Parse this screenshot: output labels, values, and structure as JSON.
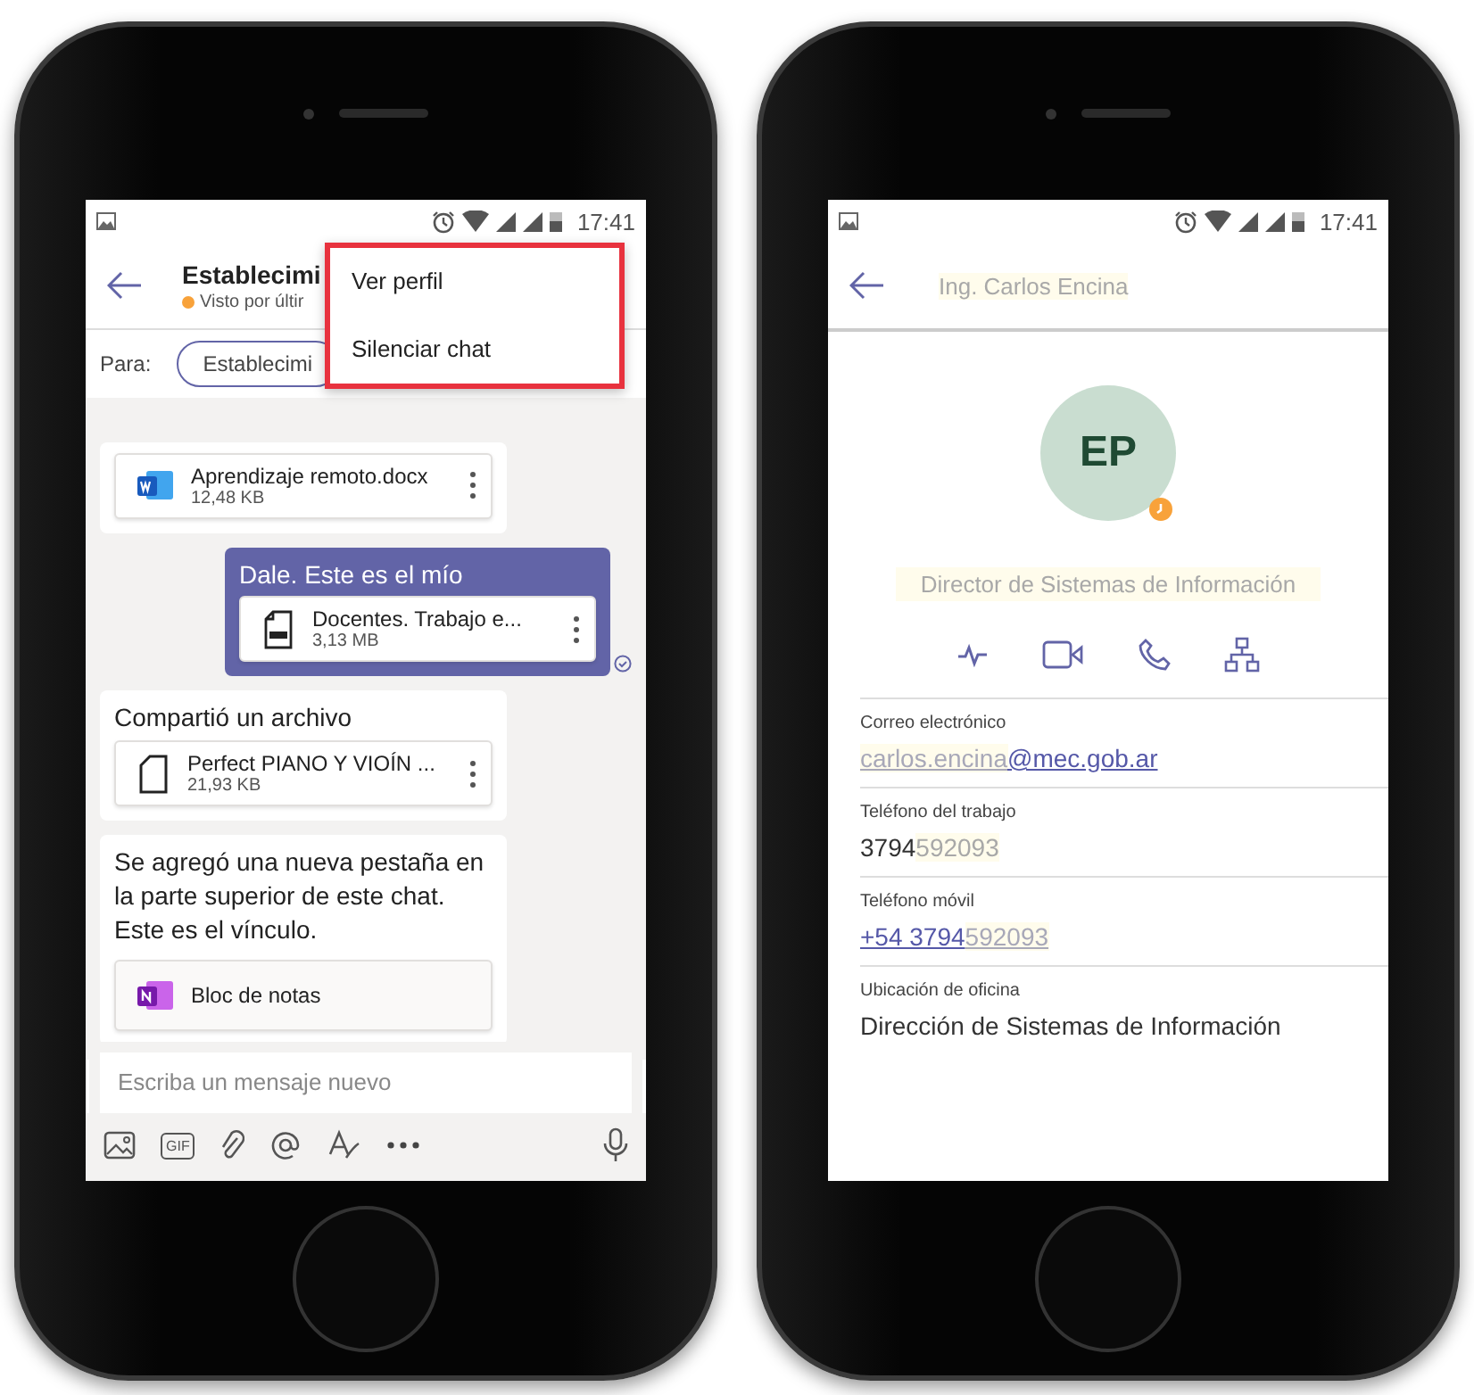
{
  "phones": [
    {
      "kind": "chat",
      "status_bar": {
        "time": "17:41"
      },
      "header": {
        "title": "Establecimi",
        "subtitle": "Visto por últir"
      },
      "recipient": {
        "label": "Para:",
        "chip": "Establecimi"
      },
      "menu": {
        "highlighted": true,
        "items": [
          "Ver perfil",
          "Silenciar chat"
        ]
      },
      "messages": [
        {
          "kind": "file_only",
          "own": false,
          "file": {
            "kind": "word",
            "name": "Aprendizaje remoto.docx",
            "size": "12,48 KB"
          }
        },
        {
          "kind": "file",
          "own": true,
          "read": true,
          "text": "Dale. Este es el mío",
          "file": {
            "kind": "pdf",
            "name": "Docentes. Trabajo e...",
            "size": "3,13 MB"
          }
        },
        {
          "kind": "file",
          "own": false,
          "text": "Compartió un archivo",
          "file": {
            "kind": "generic",
            "name": "Perfect PIANO Y VIOÍN ...",
            "size": "21,93 KB"
          }
        },
        {
          "kind": "tab",
          "own": false,
          "text": "Se agregó una nueva pestaña en la parte superior de este chat. Este es el vínculo.",
          "link": {
            "kind": "onenote",
            "name": "Bloc de notas"
          }
        }
      ],
      "compose": {
        "placeholder": "Escriba un mensaje nuevo",
        "gif_label": "GIF"
      }
    },
    {
      "kind": "profile",
      "status_bar": {
        "time": "17:41"
      },
      "header": {
        "title": "Ing. Carlos Encina",
        "redacted": true
      },
      "avatar": {
        "initials": "EP",
        "presence": {
          "kind": "away"
        }
      },
      "job_title": {
        "text": "Director de Sistemas de Información",
        "redacted": true
      },
      "fields": [
        {
          "label": "Correo electrónico",
          "link": true,
          "parts": [
            {
              "text": "carlos.encina",
              "redacted": true
            },
            {
              "text": "@mec.gob.ar",
              "redacted": false
            }
          ]
        },
        {
          "label": "Teléfono del trabajo",
          "link": false,
          "parts": [
            {
              "text": "3794",
              "redacted": false
            },
            {
              "text": "592093",
              "redacted": true
            }
          ]
        },
        {
          "label": "Teléfono móvil",
          "link": true,
          "parts": [
            {
              "text": "+54 3794",
              "redacted": false
            },
            {
              "text": "592093",
              "redacted": true
            }
          ]
        },
        {
          "label": "Ubicación de oficina",
          "link": false,
          "parts": [
            {
              "text": "Dirección de Sistemas de Información",
              "redacted": false
            }
          ]
        }
      ]
    }
  ]
}
